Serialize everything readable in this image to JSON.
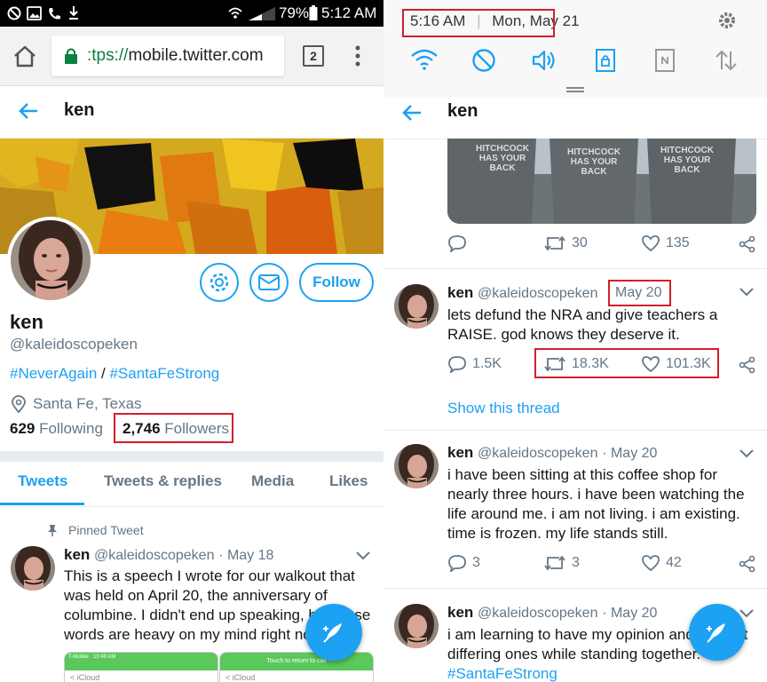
{
  "left": {
    "status_bar": {
      "battery": "79%",
      "time": "5:12 AM"
    },
    "browser": {
      "url_prefix": ":tps://",
      "url_domain": "mobile.twitter.com",
      "tab_count": "2"
    },
    "header": {
      "title": "ken"
    },
    "profile": {
      "name": "ken",
      "handle": "@kaleidoscopeken",
      "bio_tag1": "#NeverAgain",
      "bio_sep": " / ",
      "bio_tag2": "#SantaFeStrong",
      "location": "Santa Fe, Texas",
      "following_count": "629",
      "following_label": "Following",
      "followers_count": "2,746",
      "followers_label": "Followers",
      "follow_button": "Follow"
    },
    "tabs": [
      "Tweets",
      "Tweets & replies",
      "Media",
      "Likes"
    ],
    "pinned": {
      "label": "Pinned Tweet",
      "name": "ken",
      "handle": "@kaleidoscopeken",
      "date": "· May 18",
      "lines": [
        "This is a speech I wrote for our walkout that",
        "was held on April 20, the anniversary of",
        "columbine. I didn't end up speaking, but these",
        "words are heavy on my mind right now"
      ],
      "thumb1": {
        "carrier": "T-Mobile",
        "time": "10:40 AM",
        "back": "< iCloud"
      },
      "thumb2": {
        "banner": "Touch to return to call",
        "back": "< iCloud"
      }
    }
  },
  "right": {
    "notif": {
      "time": "5:16 AM",
      "date": "Mon, May 21"
    },
    "header": {
      "title": "ken"
    },
    "photo": {
      "shirt_lines": [
        "HITCHCOCK",
        "HAS YOUR",
        "BACK"
      ]
    },
    "tweet0": {
      "replies": "",
      "retweets": "30",
      "likes": "135"
    },
    "tweet1": {
      "name": "ken",
      "handle": "@kaleidoscopeken",
      "date": "May 20",
      "lines": [
        "lets defund the NRA and give teachers a",
        "RAISE. god knows they deserve it."
      ],
      "replies": "1.5K",
      "retweets": "18.3K",
      "likes": "101.3K",
      "thread": "Show this thread"
    },
    "tweet2": {
      "name": "ken",
      "handle": "@kaleidoscopeken",
      "date": "· May 20",
      "lines": [
        "i have been sitting at this coffee shop for",
        "nearly three hours. i have been watching the",
        "life around me. i am not living. i am existing.",
        "time is frozen. my life stands still."
      ],
      "replies": "3",
      "retweets": "3",
      "likes": "42"
    },
    "tweet3": {
      "name": "ken",
      "handle": "@kaleidoscopeken",
      "date": "· May 20",
      "lines": [
        "i am learning to have my opinion and respect",
        "differing ones while standing together."
      ],
      "tag": "#SantaFeStrong"
    }
  },
  "colors": {
    "twitter_blue": "#1da1f2",
    "highlight_red": "#d21f2b",
    "status_bar": "#000000"
  }
}
